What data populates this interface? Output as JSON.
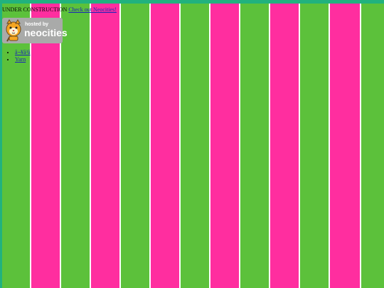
{
  "header": {
    "status_text": "UNDER CONSTRUCTION",
    "neocities_link": "Check out Neocities!"
  },
  "badge": {
    "small_text": "hosted by",
    "big_text": "neocities",
    "icon": "neocities-cat-icon"
  },
  "links": [
    {
      "label": "ã¬¥ã³ã"
    },
    {
      "label": "Yarn"
    }
  ],
  "colors": {
    "frame": "#21b27e",
    "green_stripe": "#5cc13b",
    "pink_stripe": "#ff2e9f",
    "stripe_border": "#ffffff",
    "link": "#1a24b8",
    "badge_bg": "#a9aaa9"
  }
}
